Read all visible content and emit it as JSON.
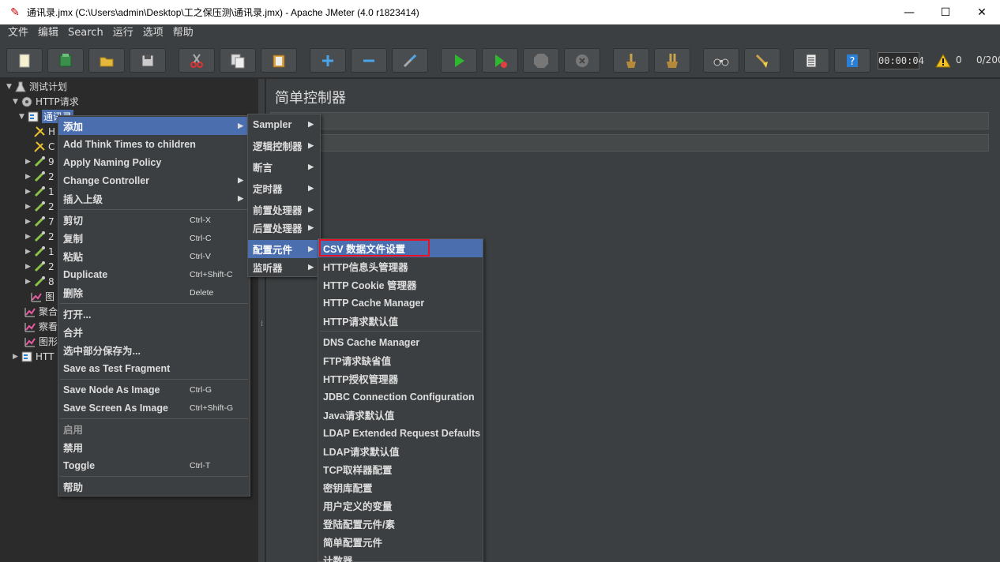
{
  "window": {
    "title": "通讯录.jmx (C:\\Users\\admin\\Desktop\\工之保压测\\通讯录.jmx) - Apache JMeter (4.0 r1823414)",
    "minimize": "—",
    "maximize": "☐",
    "close": "✕"
  },
  "menubar": [
    "文件",
    "编辑",
    "Search",
    "运行",
    "选项",
    "帮助"
  ],
  "toolbar": {
    "timer": "00:00:04",
    "warning_count": "0",
    "thread_count": "0/200",
    "buttons": [
      "new-icon",
      "templates-icon",
      "open-icon",
      "save-icon",
      "cut-icon",
      "copy-icon",
      "paste-icon",
      "expand-icon",
      "collapse-icon",
      "toggle-icon",
      "start-icon",
      "start-no-pause-icon",
      "stop-icon",
      "shutdown-icon",
      "clear-icon",
      "clear-all-icon",
      "search-icon",
      "reset-search-icon",
      "function-helper-icon",
      "help-icon"
    ]
  },
  "tree": {
    "root": "测试计划",
    "thread_group": "HTTP请求",
    "selected": "通讯录",
    "children": [
      "H",
      "C",
      "9",
      "2",
      "1",
      "2",
      "7",
      "2",
      "1",
      "2",
      "8",
      "图"
    ],
    "listeners": [
      "聚合",
      "察看",
      "图形"
    ],
    "last": "HTT"
  },
  "panel": {
    "title": "简单控制器",
    "name_value": "通讯录",
    "comment_value": "录"
  },
  "context_menu": {
    "add": "添加",
    "add_think_times": "Add Think Times to children",
    "apply_naming": "Apply Naming Policy",
    "change_controller": "Change Controller",
    "insert_parent": "插入上级",
    "cut": "剪切",
    "cut_key": "Ctrl-X",
    "copy": "复制",
    "copy_key": "Ctrl-C",
    "paste": "粘贴",
    "paste_key": "Ctrl-V",
    "duplicate": "Duplicate",
    "duplicate_key": "Ctrl+Shift-C",
    "delete": "删除",
    "delete_key": "Delete",
    "open": "打开...",
    "merge": "合并",
    "save_selection": "选中部分保存为...",
    "save_fragment": "Save as Test Fragment",
    "save_node_image": "Save Node As Image",
    "save_node_image_key": "Ctrl-G",
    "save_screen_image": "Save Screen As Image",
    "save_screen_image_key": "Ctrl+Shift-G",
    "enable": "启用",
    "disable": "禁用",
    "toggle": "Toggle",
    "toggle_key": "Ctrl-T",
    "help": "帮助"
  },
  "add_submenu": [
    "Sampler",
    "逻辑控制器",
    "断言",
    "定时器",
    "前置处理器",
    "后置处理器",
    "配置元件",
    "监听器"
  ],
  "config_submenu": [
    "CSV 数据文件设置",
    "HTTP信息头管理器",
    "HTTP Cookie 管理器",
    "HTTP Cache Manager",
    "HTTP请求默认值",
    "DNS Cache Manager",
    "FTP请求缺省值",
    "HTTP授权管理器",
    "JDBC Connection Configuration",
    "Java请求默认值",
    "LDAP Extended Request Defaults",
    "LDAP请求默认值",
    "TCP取样器配置",
    "密钥库配置",
    "用户定义的变量",
    "登陆配置元件/素",
    "简单配置元件",
    "计数器"
  ]
}
